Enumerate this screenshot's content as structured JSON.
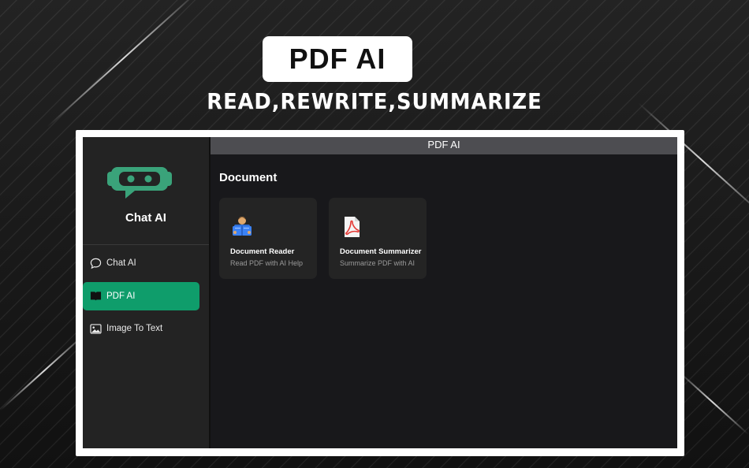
{
  "hero": {
    "badge": "PDF AI",
    "subtitle": "READ,REWRITE,SUMMARIZE"
  },
  "window": {
    "title": "PDF AI"
  },
  "sidebar": {
    "brand_name": "Chat AI",
    "brand_icon": "robot-chat-icon",
    "items": [
      {
        "label": "Chat AI",
        "icon": "chat-bubble-icon",
        "active": false
      },
      {
        "label": "PDF AI",
        "icon": "book-icon",
        "active": true
      },
      {
        "label": "Image To Text",
        "icon": "image-icon",
        "active": false
      }
    ]
  },
  "main": {
    "section_title": "Document",
    "cards": [
      {
        "title": "Document Reader",
        "subtitle": "Read PDF with AI Help",
        "icon": "person-reading-icon"
      },
      {
        "title": "Document Summarizer",
        "subtitle": "Summarize PDF with AI",
        "icon": "pdf-file-icon"
      }
    ]
  },
  "colors": {
    "accent": "#0f9d6b",
    "brand_green": "#3aa37a",
    "titlebar": "#4d4d51",
    "sidebar": "#232323",
    "content": "#18181b"
  }
}
